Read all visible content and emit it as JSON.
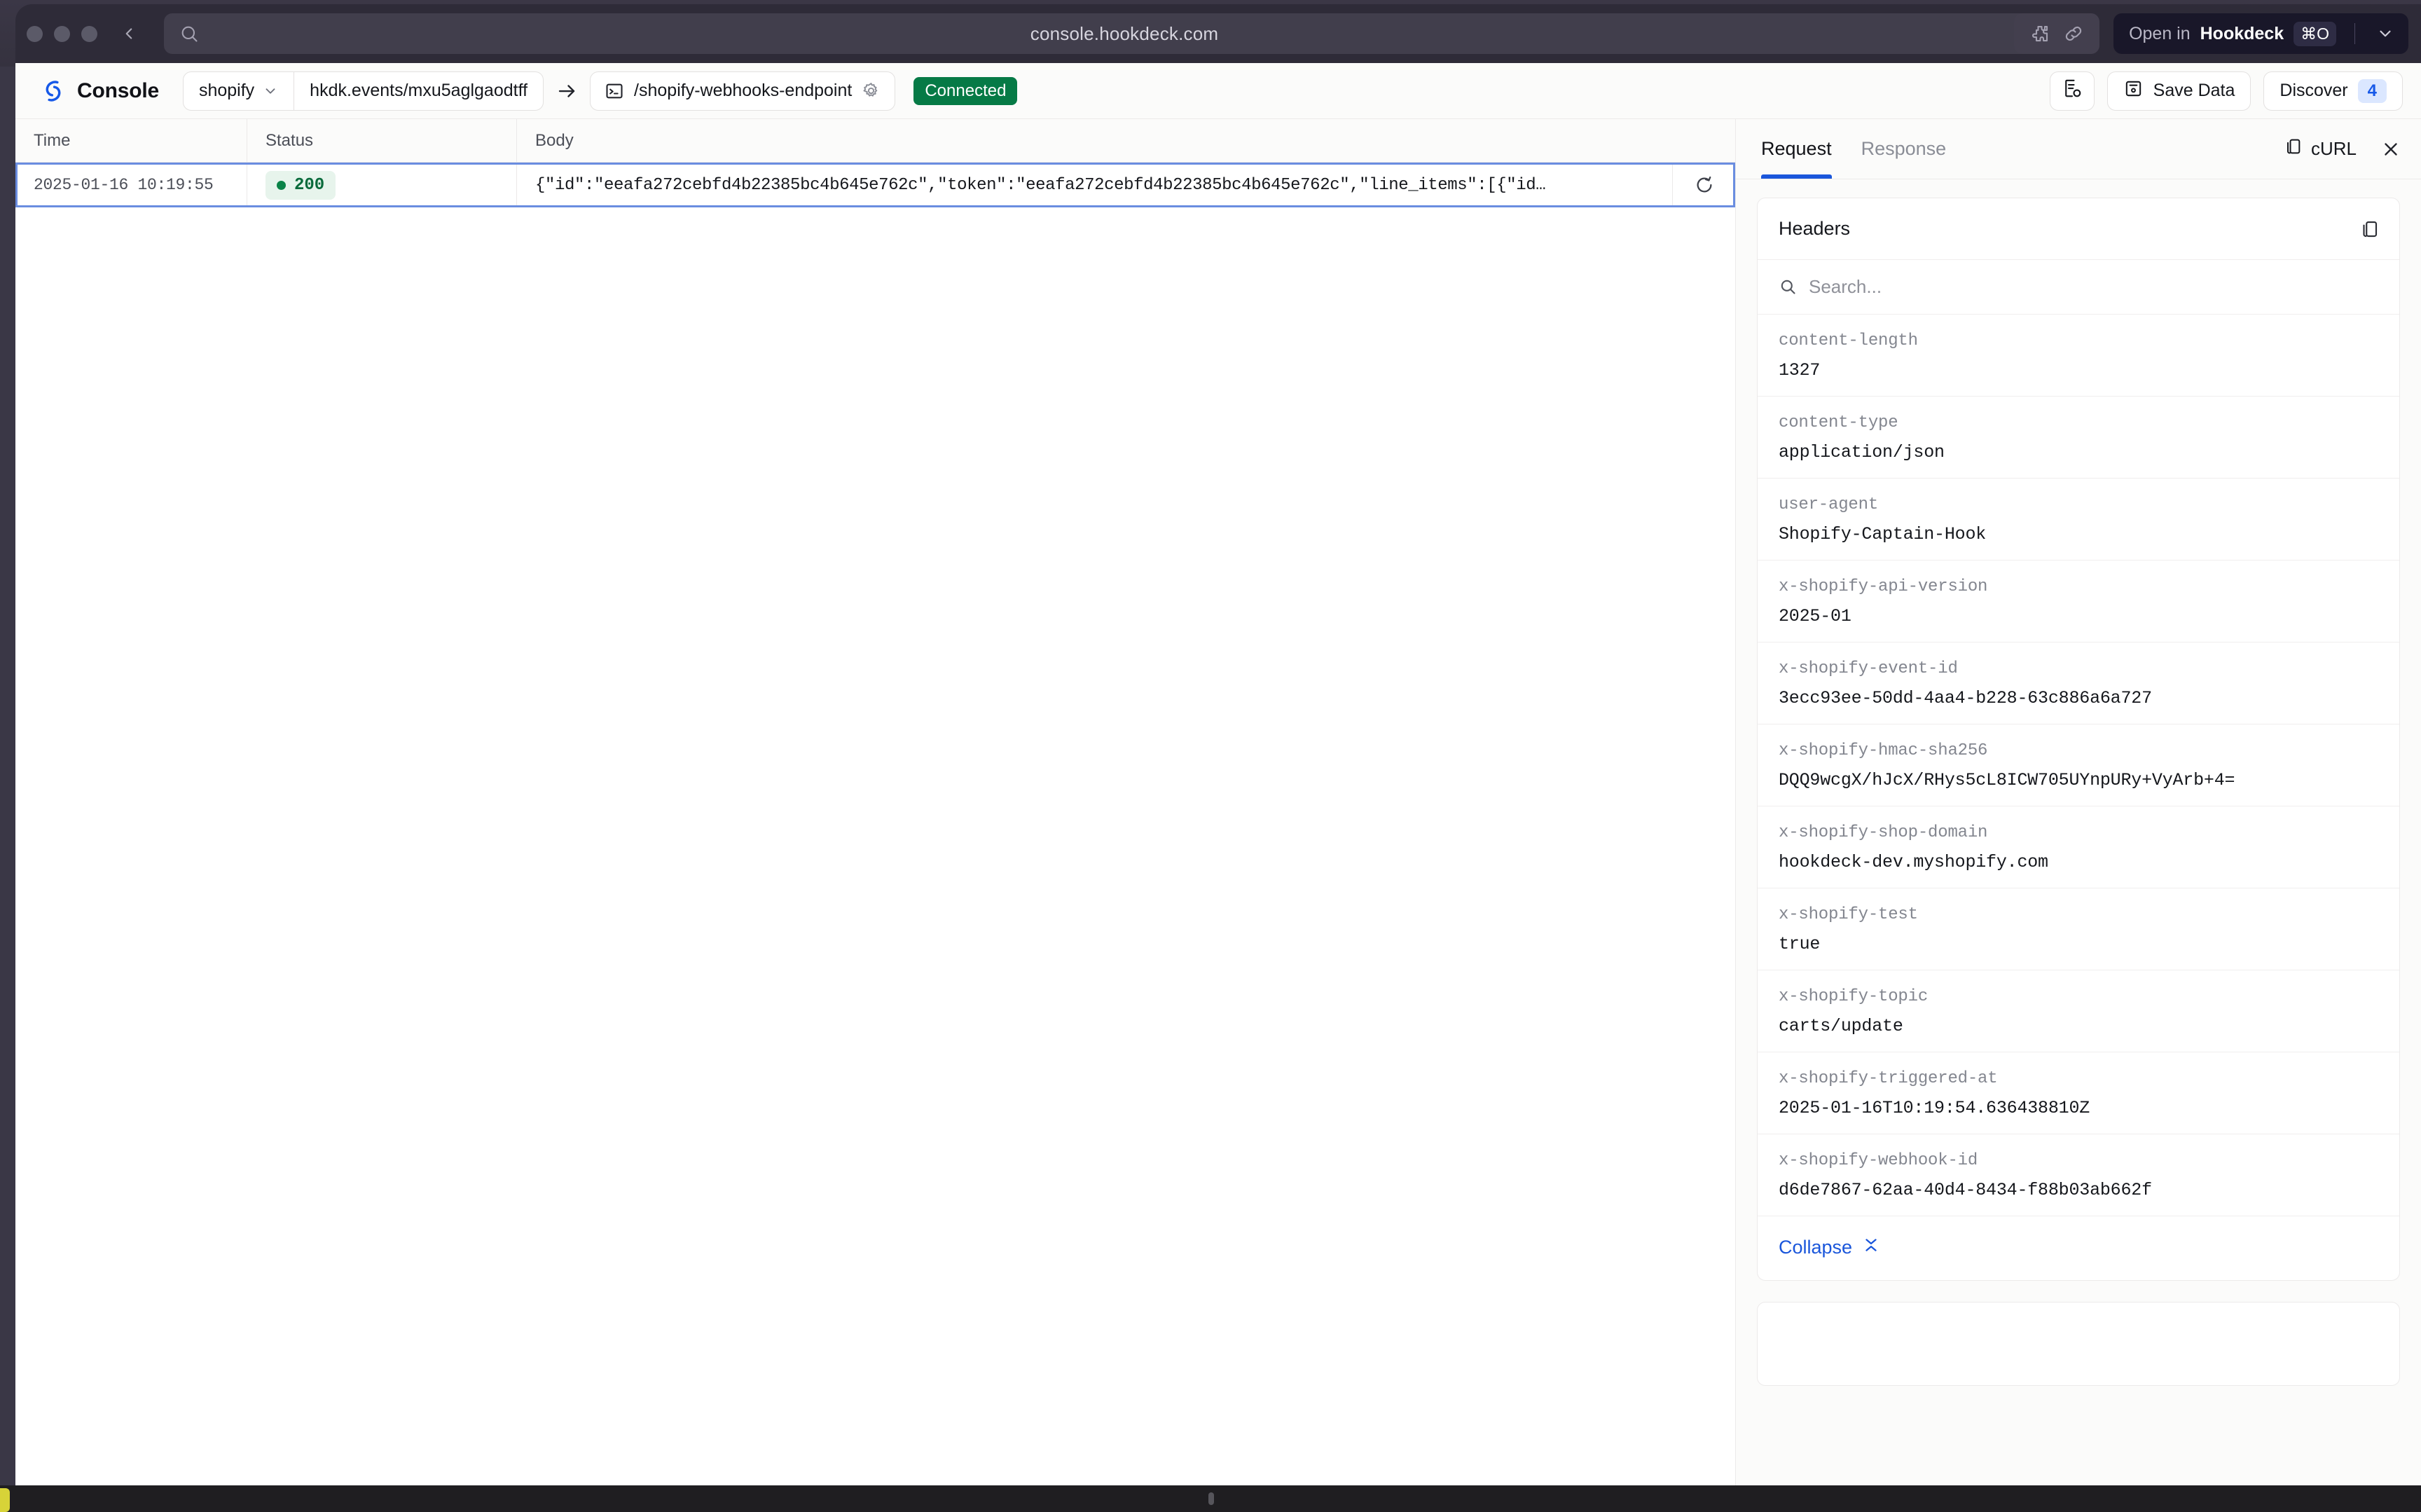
{
  "browser": {
    "url": "console.hookdeck.com",
    "search_icon": "search-icon",
    "back_icon": "chevron-left-icon",
    "extensions_icon": "puzzle-icon",
    "link_icon": "link-icon",
    "open_label_light": "Open in",
    "open_label_strong": "Hookdeck",
    "open_shortcut": "⌘O",
    "dropdown_icon": "chevron-down-icon"
  },
  "header": {
    "brand": "Console",
    "source": "shopify",
    "source_caret": "chevron-down-icon",
    "event_url": "hkdk.events/mxu5aglgaodtff",
    "arrow_icon": "arrow-right-icon",
    "endpoint": "/shopify-webhooks-endpoint",
    "endpoint_icon": "terminal-icon",
    "endpoint_settings_icon": "gear-icon",
    "status": "Connected",
    "status_color": "#067a46",
    "file_button_icon": "file-export-icon",
    "save_label": "Save Data",
    "save_icon": "save-icon",
    "discover_label": "Discover",
    "discover_count": "4",
    "discover_count_color": "#1759e8"
  },
  "table": {
    "columns": [
      "Time",
      "Status",
      "Body"
    ],
    "rows": [
      {
        "time": "2025-01-16 10:19:55",
        "status": "200",
        "status_dot_color": "#0a8348",
        "body": "{\"id\":\"eeafa272cebfd4b22385bc4b645e762c\",\"token\":\"eeafa272cebfd4b22385bc4b645e762c\",\"line_items\":[{\"id…",
        "retry_icon": "retry-icon"
      }
    ]
  },
  "details": {
    "tabs": [
      {
        "label": "Request",
        "active": true
      },
      {
        "label": "Response",
        "active": false
      }
    ],
    "curl_label": "cURL",
    "curl_icon": "copy-icon",
    "close_icon": "close-icon",
    "headers_card": {
      "title": "Headers",
      "copy_icon": "copy-icon",
      "search_placeholder": "Search...",
      "search_value": "",
      "search_icon": "search-icon",
      "items": [
        {
          "key": "content-length",
          "value": "1327"
        },
        {
          "key": "content-type",
          "value": "application/json"
        },
        {
          "key": "user-agent",
          "value": "Shopify-Captain-Hook"
        },
        {
          "key": "x-shopify-api-version",
          "value": "2025-01"
        },
        {
          "key": "x-shopify-event-id",
          "value": "3ecc93ee-50dd-4aa4-b228-63c886a6a727"
        },
        {
          "key": "x-shopify-hmac-sha256",
          "value": "DQQ9wcgX/hJcX/RHys5cL8ICW705UYnpURy+VyArb+4="
        },
        {
          "key": "x-shopify-shop-domain",
          "value": "hookdeck-dev.myshopify.com"
        },
        {
          "key": "x-shopify-test",
          "value": "true"
        },
        {
          "key": "x-shopify-topic",
          "value": "carts/update"
        },
        {
          "key": "x-shopify-triggered-at",
          "value": "2025-01-16T10:19:54.636438810Z"
        },
        {
          "key": "x-shopify-webhook-id",
          "value": "d6de7867-62aa-40d4-8434-f88b03ab662f"
        }
      ],
      "collapse_label": "Collapse",
      "collapse_icon": "collapse-icon"
    }
  }
}
